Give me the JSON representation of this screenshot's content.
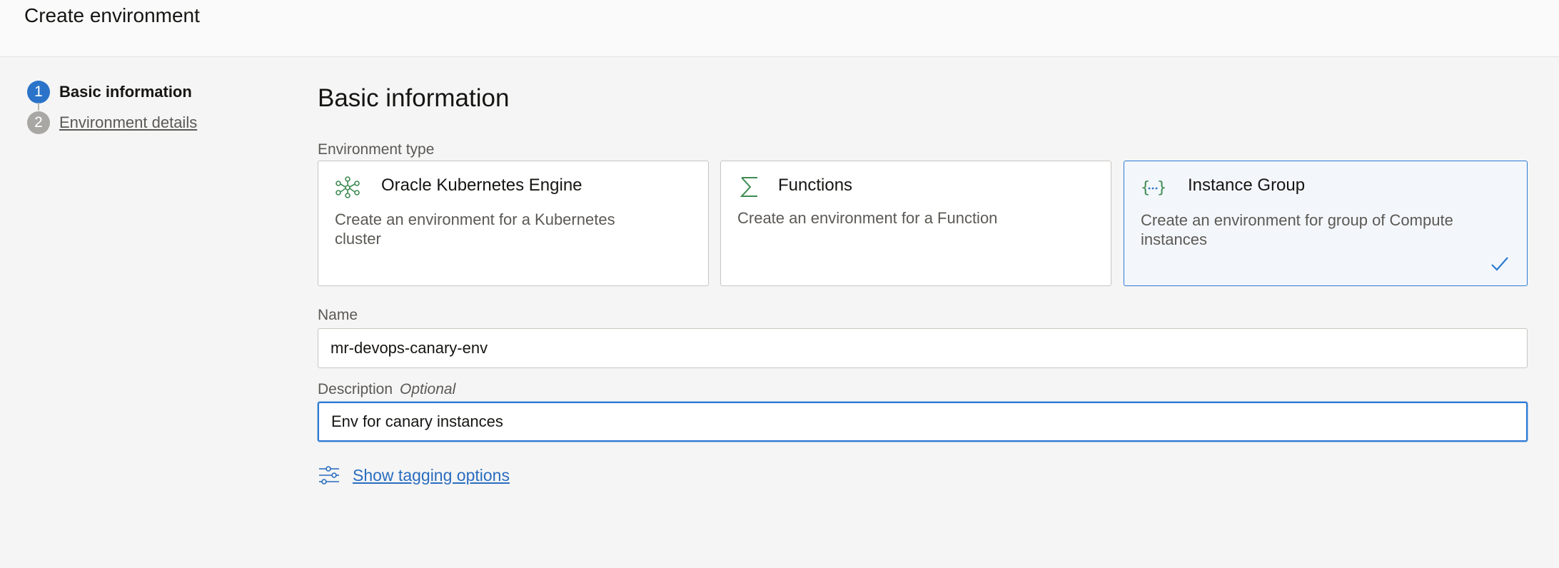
{
  "page": {
    "title": "Create environment"
  },
  "steps": [
    {
      "number": "1",
      "label": "Basic information",
      "state": "active"
    },
    {
      "number": "2",
      "label": "Environment details",
      "state": "inactive"
    }
  ],
  "main": {
    "title": "Basic information",
    "environment_type": {
      "label": "Environment type",
      "options": [
        {
          "icon": "kubernetes-icon",
          "title": "Oracle Kubernetes Engine",
          "description": "Create an environment for a Kubernetes cluster",
          "selected": false
        },
        {
          "icon": "sigma-icon",
          "title": "Functions",
          "description": "Create an environment for a Function",
          "selected": false
        },
        {
          "icon": "braces-icon",
          "title": "Instance Group",
          "description": "Create an environment for group of Compute instances",
          "selected": true
        }
      ]
    },
    "name": {
      "label": "Name",
      "value": "mr-devops-canary-env"
    },
    "description": {
      "label": "Description",
      "optional_label": "Optional",
      "value": "Env for canary instances"
    },
    "tagging": {
      "icon": "sliders-icon",
      "label": "Show tagging options"
    }
  },
  "colors": {
    "accent": "#2a73c9",
    "selected_border": "#2d7ad3",
    "selected_background": "#f3f7fb",
    "link": "#2a6dbf",
    "icon_green": "#3f8b52"
  }
}
